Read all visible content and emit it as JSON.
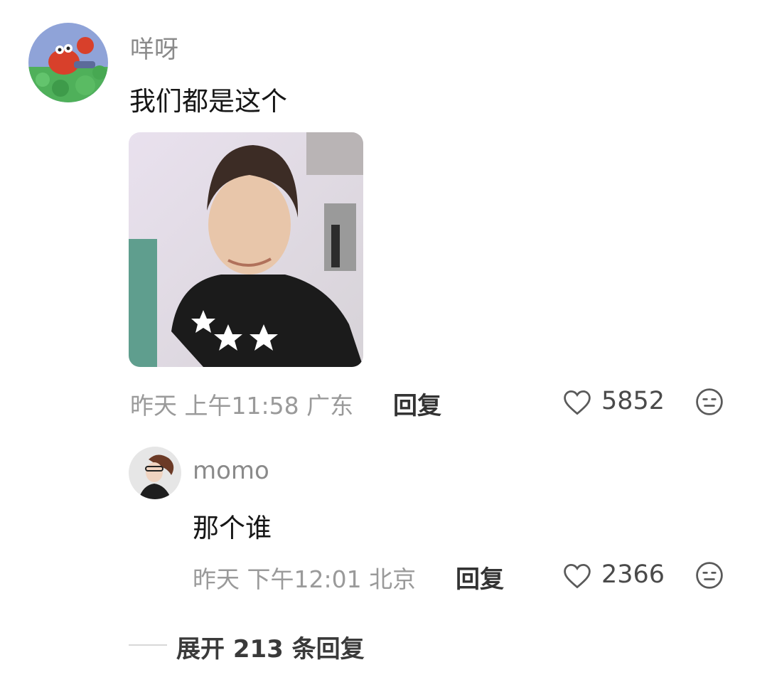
{
  "comment": {
    "username": "咩呀",
    "text": "我们都是这个",
    "meta": "昨天 上午11:58 广东",
    "reply_label": "回复",
    "like_count": "5852"
  },
  "reply": {
    "username": "momo",
    "text": "那个谁",
    "meta": "昨天 下午12:01 北京",
    "reply_label": "回复",
    "like_count": "2366"
  },
  "expand": {
    "label": "展开 213 条回复"
  },
  "icons": {
    "like": "heart-outline-icon",
    "emoji": "neutral-face-icon"
  },
  "colors": {
    "meta_text": "#9a9a9a",
    "username": "#8a8a8a"
  }
}
